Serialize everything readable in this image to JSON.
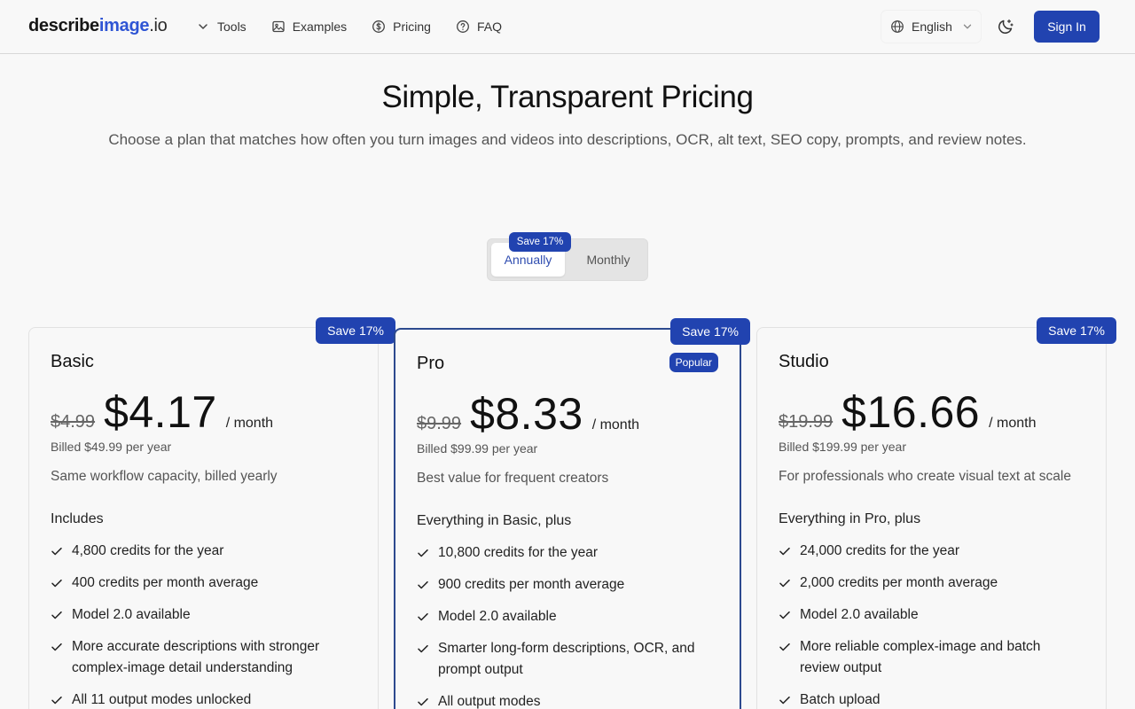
{
  "header": {
    "logo": {
      "part1": "describe",
      "part2": "image",
      "part3": ".io"
    },
    "nav": [
      {
        "label": "Tools",
        "icon": "chevron-down-icon"
      },
      {
        "label": "Examples",
        "icon": "image-icon"
      },
      {
        "label": "Pricing",
        "icon": "dollar-circle-icon"
      },
      {
        "label": "FAQ",
        "icon": "help-circle-icon"
      }
    ],
    "language": "English",
    "signin": "Sign In"
  },
  "hero": {
    "title": "Simple, Transparent Pricing",
    "subtitle": "Choose a plan that matches how often you turn images and videos into descriptions, OCR, alt text, SEO copy, prompts, and review notes."
  },
  "toggle": {
    "annually": "Annually",
    "monthly": "Monthly",
    "badge": "Save 17%",
    "selected": "Annually"
  },
  "plans": [
    {
      "name": "Basic",
      "save": "Save 17%",
      "old_price": "$4.99",
      "price": "$4.17",
      "per": "/ month",
      "billed": "Billed $49.99 per year",
      "description": "Same workflow capacity, billed yearly",
      "includes": "Includes",
      "features": [
        "4,800 credits for the year",
        "400 credits per month average",
        "Model 2.0 available",
        "More accurate descriptions with stronger complex-image detail understanding",
        "All 11 output modes unlocked"
      ]
    },
    {
      "name": "Pro",
      "save": "Save 17%",
      "badge": "Popular",
      "old_price": "$9.99",
      "price": "$8.33",
      "per": "/ month",
      "billed": "Billed $99.99 per year",
      "description": "Best value for frequent creators",
      "includes": "Everything in Basic, plus",
      "features": [
        "10,800 credits for the year",
        "900 credits per month average",
        "Model 2.0 available",
        "Smarter long-form descriptions, OCR, and prompt output",
        "All output modes"
      ]
    },
    {
      "name": "Studio",
      "save": "Save 17%",
      "old_price": "$19.99",
      "price": "$16.66",
      "per": "/ month",
      "billed": "Billed $199.99 per year",
      "description": "For professionals who create visual text at scale",
      "includes": "Everything in Pro, plus",
      "features": [
        "24,000 credits for the year",
        "2,000 credits per month average",
        "Model 2.0 available",
        "More reliable complex-image and batch review output",
        "Batch upload"
      ]
    }
  ],
  "colors": {
    "accent": "#2143b0",
    "logo_accent": "#2f55d4",
    "pro_border": "#2d4a8f"
  }
}
